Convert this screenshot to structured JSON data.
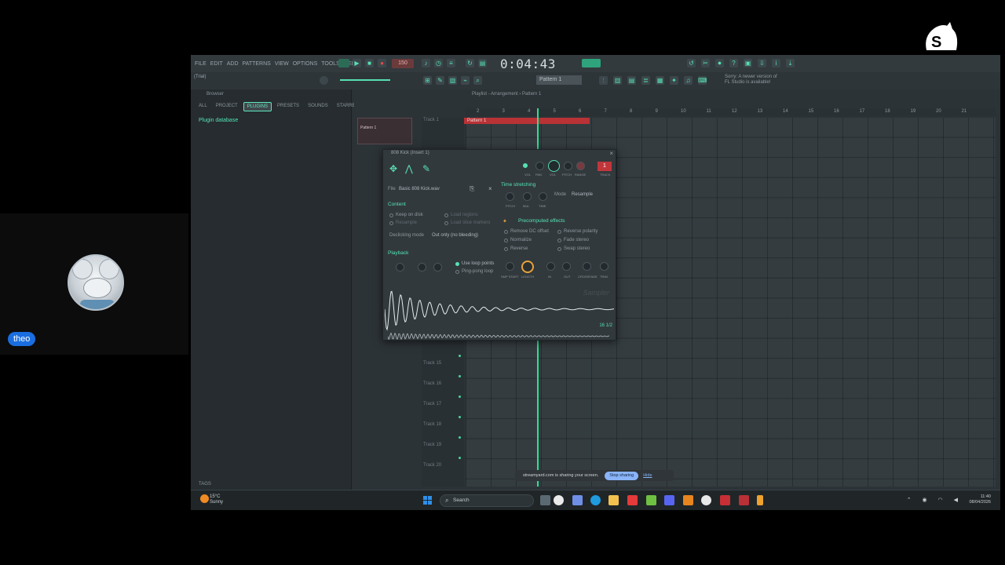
{
  "participant": {
    "name": "theo"
  },
  "branding": {
    "logo_text": "streamyard"
  },
  "fl": {
    "menu": [
      "FILE",
      "EDIT",
      "ADD",
      "PATTERNS",
      "VIEW",
      "OPTIONS",
      "TOOLS",
      "HELP"
    ],
    "tempo": "150",
    "time": "0:04:43",
    "pattern": "Pattern 1",
    "hint": "Sorry: A newer version of FL Studio is available!",
    "trial": "(Trial)"
  },
  "browser": {
    "title": "Browser",
    "tabs": [
      "ALL",
      "PROJECT",
      "PLUGINS",
      "PRESETS",
      "SOUNDS",
      "STARRED"
    ],
    "active_tab": "PLUGINS",
    "db_label": "Plugin database",
    "tags_label": "TAGS"
  },
  "playlist": {
    "title": "Playlist - Arrangement › Pattern 1",
    "pattern_clip": "Pattern 1",
    "ruler": [
      "2",
      "3",
      "4",
      "5",
      "6",
      "7",
      "8",
      "9",
      "10",
      "11",
      "12",
      "13",
      "14",
      "15",
      "16",
      "17",
      "18",
      "19",
      "20",
      "21"
    ],
    "tracks": [
      "Track 1",
      "Track 15",
      "Track 16",
      "Track 17",
      "Track 18",
      "Track 19",
      "Track 20"
    ]
  },
  "sampler": {
    "title": "808 Kick (Insert 1)",
    "file": "Basic 808 Kick.wav",
    "file_label": "File",
    "track_num": "1",
    "sections": {
      "content": "Content",
      "playback": "Playback",
      "time_stretching": "Time stretching",
      "precomputed": "Precomputed effects"
    },
    "content_opts": [
      "Keep on disk",
      "Resample",
      "Load regions",
      "Load slice markers"
    ],
    "declicking_label": "Declicking mode",
    "declicking_value": "Out only (no bleeding)",
    "playback_opts": [
      "Use loop points",
      "Ping-pong loop"
    ],
    "mode_label": "Mode",
    "mode_value": "Resample",
    "effects": [
      "Remove DC offset",
      "Normalize",
      "Reverse",
      "Reverse polarity",
      "Fade stereo",
      "Swap stereo"
    ],
    "knob_labels": [
      "PITCH",
      "MUL",
      "TIME",
      "SMP START",
      "LENGTH",
      "IN",
      "OUT",
      "CROSSFADE",
      "TRIM"
    ],
    "top_labels": [
      "VOL",
      "PAN",
      "VOL",
      "PITCH",
      "RANGE",
      "TRACK"
    ],
    "watermark": "Sampler",
    "bits": "16 1/2"
  },
  "share": {
    "text": "streamyard.com is sharing your screen.",
    "stop": "Stop sharing",
    "hide": "Hide"
  },
  "taskbar": {
    "temp": "15°C",
    "weather": "Sunny",
    "search": "Search",
    "time": "11:40",
    "date": "08/04/2026"
  }
}
